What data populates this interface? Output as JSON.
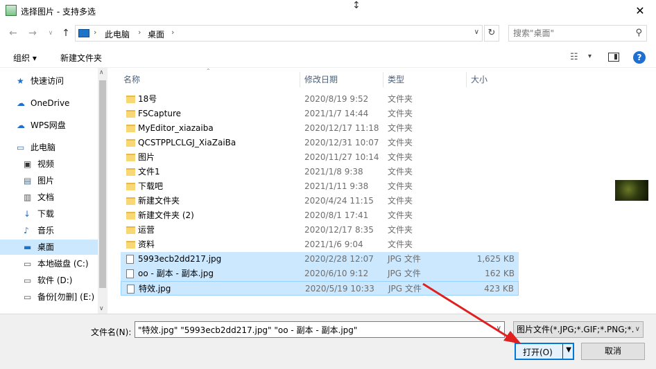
{
  "window": {
    "title": "选择图片 - 支持多选"
  },
  "address": {
    "crumbs": [
      "此电脑",
      "桌面"
    ],
    "search_placeholder": "搜索\"桌面\""
  },
  "toolbar": {
    "organize": "组织 ▾",
    "new_folder": "新建文件夹"
  },
  "nav": {
    "items": [
      {
        "label": "快速访问",
        "icon": "star-icon",
        "selected": false
      },
      {
        "label": "OneDrive",
        "icon": "cloud-icon",
        "selected": false
      },
      {
        "label": "WPS网盘",
        "icon": "cloud-icon",
        "selected": false
      },
      {
        "label": "此电脑",
        "icon": "computer-icon",
        "selected": false
      },
      {
        "label": "视频",
        "icon": "video-icon",
        "selected": false
      },
      {
        "label": "图片",
        "icon": "picture-icon",
        "selected": false
      },
      {
        "label": "文档",
        "icon": "document-icon",
        "selected": false
      },
      {
        "label": "下载",
        "icon": "download-icon",
        "selected": false
      },
      {
        "label": "音乐",
        "icon": "music-icon",
        "selected": false
      },
      {
        "label": "桌面",
        "icon": "desktop-icon",
        "selected": true
      },
      {
        "label": "本地磁盘 (C:)",
        "icon": "drive-icon",
        "selected": false
      },
      {
        "label": "软件 (D:)",
        "icon": "drive-icon",
        "selected": false
      },
      {
        "label": "备份[勿删] (E:)",
        "icon": "drive-icon",
        "selected": false
      }
    ]
  },
  "columns": {
    "name": "名称",
    "date": "修改日期",
    "type": "类型",
    "size": "大小"
  },
  "files": [
    {
      "name": "18号",
      "date": "2020/8/19 9:52",
      "type": "文件夹",
      "size": "",
      "kind": "folder",
      "selected": false
    },
    {
      "name": "FSCapture",
      "date": "2021/1/7 14:44",
      "type": "文件夹",
      "size": "",
      "kind": "folder",
      "selected": false
    },
    {
      "name": "MyEditor_xiazaiba",
      "date": "2020/12/17 11:18",
      "type": "文件夹",
      "size": "",
      "kind": "folder",
      "selected": false
    },
    {
      "name": "QCSTPPLCLGJ_XiaZaiBa",
      "date": "2020/12/31 10:07",
      "type": "文件夹",
      "size": "",
      "kind": "folder",
      "selected": false
    },
    {
      "name": "图片",
      "date": "2020/11/27 10:14",
      "type": "文件夹",
      "size": "",
      "kind": "folder",
      "selected": false
    },
    {
      "name": "文件1",
      "date": "2021/1/8 9:38",
      "type": "文件夹",
      "size": "",
      "kind": "folder",
      "selected": false
    },
    {
      "name": "下载吧",
      "date": "2021/1/11 9:38",
      "type": "文件夹",
      "size": "",
      "kind": "folder",
      "selected": false
    },
    {
      "name": "新建文件夹",
      "date": "2020/4/24 11:15",
      "type": "文件夹",
      "size": "",
      "kind": "folder",
      "selected": false
    },
    {
      "name": "新建文件夹 (2)",
      "date": "2020/8/1 17:41",
      "type": "文件夹",
      "size": "",
      "kind": "folder",
      "selected": false
    },
    {
      "name": "运营",
      "date": "2020/12/17 8:35",
      "type": "文件夹",
      "size": "",
      "kind": "folder",
      "selected": false
    },
    {
      "name": "资料",
      "date": "2021/1/6 9:04",
      "type": "文件夹",
      "size": "",
      "kind": "folder",
      "selected": false
    },
    {
      "name": "5993ecb2dd217.jpg",
      "date": "2020/2/28 12:07",
      "type": "JPG 文件",
      "size": "1,625 KB",
      "kind": "file",
      "selected": true
    },
    {
      "name": "oo - 副本 - 副本.jpg",
      "date": "2020/6/10 9:12",
      "type": "JPG 文件",
      "size": "162 KB",
      "kind": "file",
      "selected": true
    },
    {
      "name": "特效.jpg",
      "date": "2020/5/19 10:33",
      "type": "JPG 文件",
      "size": "423 KB",
      "kind": "file",
      "selected": true
    }
  ],
  "bottom": {
    "filename_label": "文件名(N):",
    "filename_value": "\"特效.jpg\" \"5993ecb2dd217.jpg\" \"oo - 副本 - 副本.jpg\"",
    "filter_value": "图片文件(*.JPG;*.GIF;*.PNG;*.B",
    "open_label": "打开(O)",
    "cancel_label": "取消"
  },
  "colors": {
    "selection": "#cce8ff",
    "accent": "#0078d7",
    "annotation_arrow": "#e02020"
  }
}
